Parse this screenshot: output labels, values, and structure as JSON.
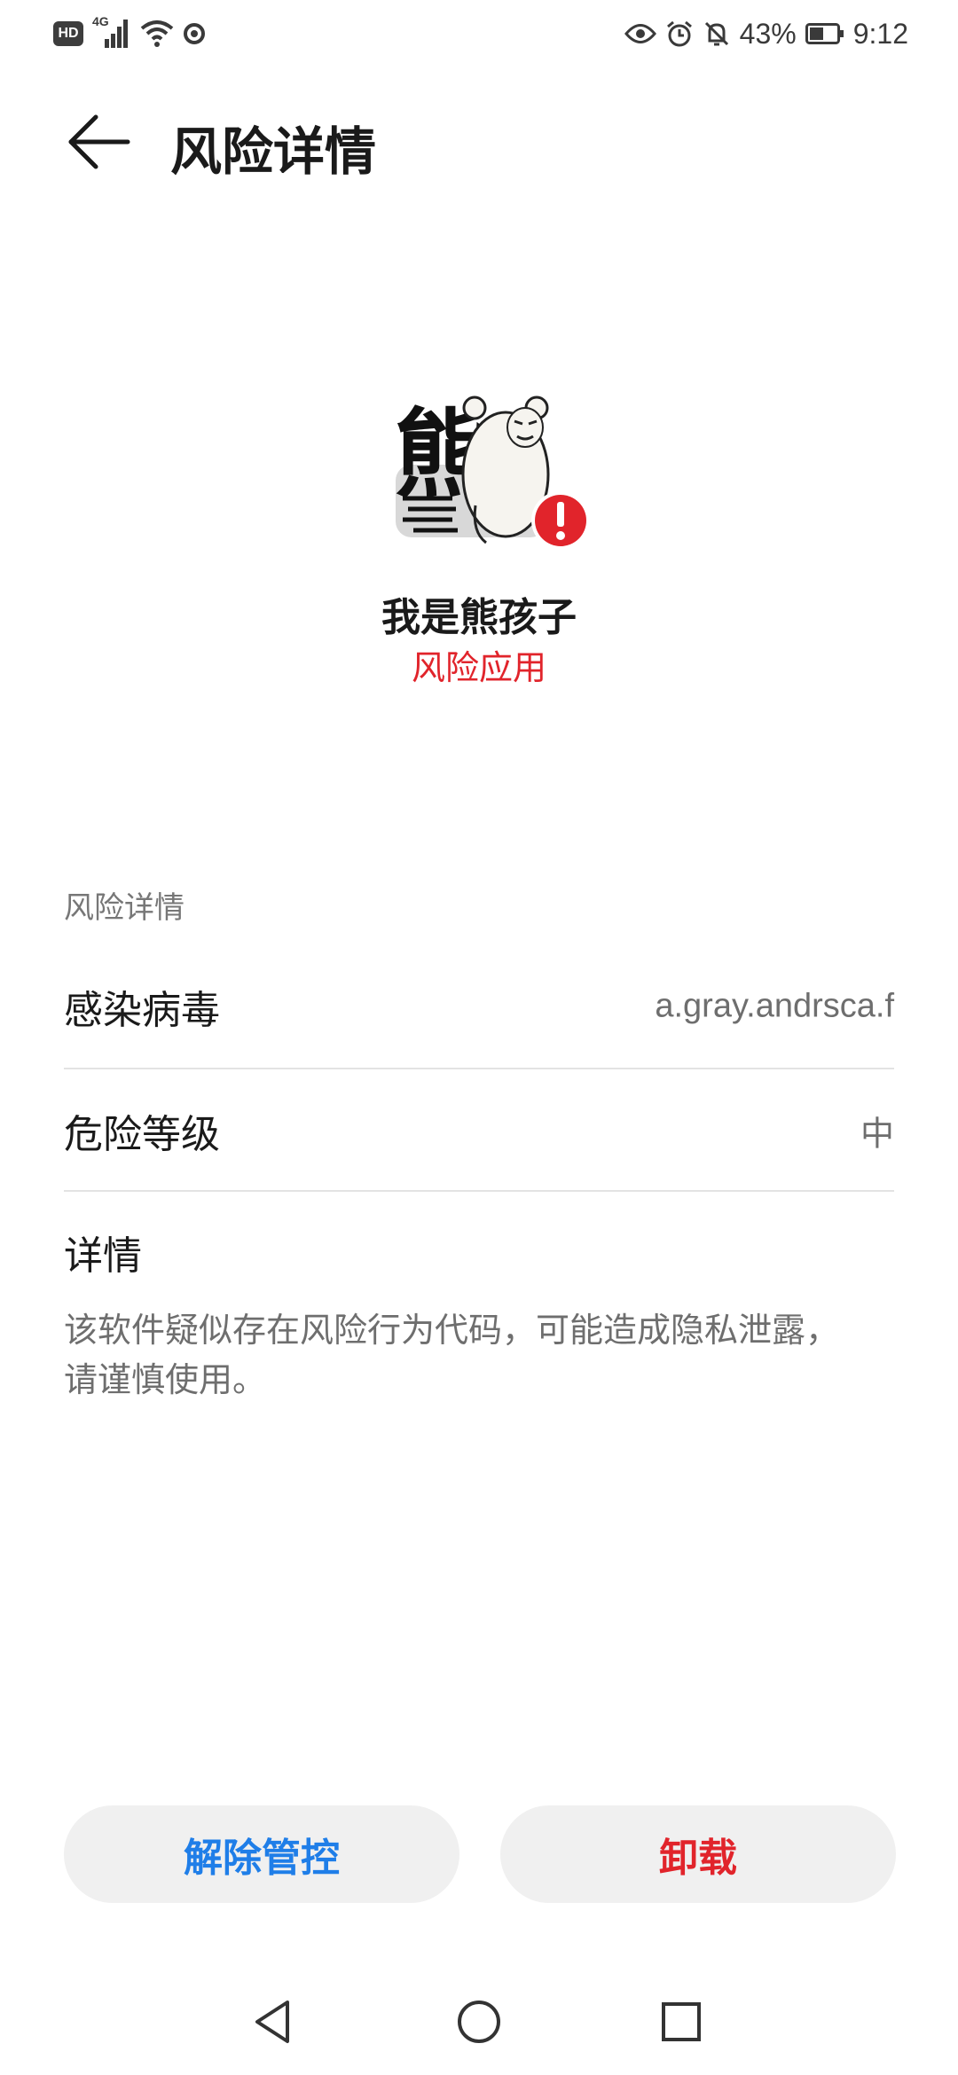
{
  "status_bar": {
    "network_type": "4G",
    "battery_percent": "43%",
    "time": "9:12",
    "icons": [
      "hd-icon",
      "signal-icon",
      "wifi-icon",
      "vpn-icon",
      "eye-icon",
      "alarm-icon",
      "mute-bell-icon",
      "battery-icon"
    ]
  },
  "header": {
    "title": "风险详情",
    "back_icon": "back-arrow-icon"
  },
  "app": {
    "icon": "bear-app-icon",
    "icon_glyph": "熊",
    "name": "我是熊孩子",
    "status": "风险应用",
    "status_color": "#e1242b"
  },
  "risk_details": {
    "section_label": "风险详情",
    "rows": [
      {
        "label": "感染病毒",
        "value": "a.gray.andrsca.f"
      },
      {
        "label": "危险等级",
        "value": "中"
      }
    ],
    "detail_label": "详情",
    "detail_text": "该软件疑似存在风险行为代码，可能造成隐私泄露，请谨慎使用。"
  },
  "actions": {
    "release_label": "解除管控",
    "uninstall_label": "卸载",
    "release_color": "#1f7ee8",
    "uninstall_color": "#e1242b"
  },
  "nav_bar": {
    "icons": [
      "nav-back-icon",
      "nav-home-icon",
      "nav-recents-icon"
    ]
  }
}
